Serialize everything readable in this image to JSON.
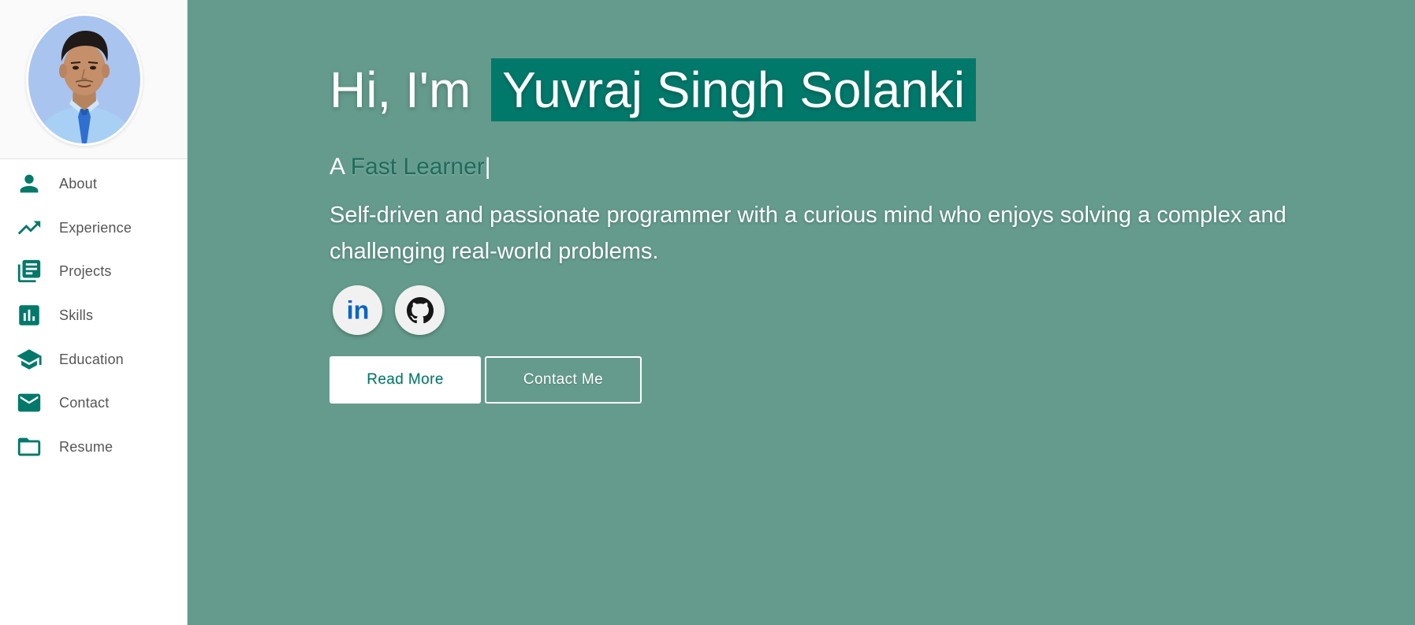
{
  "sidebar": {
    "avatar_alt": "Profile photo",
    "items": [
      {
        "label": "About",
        "icon": "person-icon"
      },
      {
        "label": "Experience",
        "icon": "trending-up-icon"
      },
      {
        "label": "Projects",
        "icon": "library-books-icon"
      },
      {
        "label": "Skills",
        "icon": "bar-chart-icon"
      },
      {
        "label": "Education",
        "icon": "school-icon"
      },
      {
        "label": "Contact",
        "icon": "mail-icon"
      },
      {
        "label": "Resume",
        "icon": "folder-icon"
      }
    ]
  },
  "hero": {
    "greeting_prefix": "Hi, I'm",
    "name": "Yuvraj Singh Solanki",
    "tagline_prefix": "A",
    "tagline_typed": "Fast Learner",
    "tagline_cursor": "|",
    "bio": "Self-driven and passionate programmer with a curious mind who enjoys solving a complex and challenging real-world problems.",
    "socials": [
      {
        "name": "linkedin-icon",
        "label": "in"
      },
      {
        "name": "github-icon"
      }
    ],
    "buttons": {
      "read_more": "Read More",
      "contact_me": "Contact Me"
    }
  },
  "colors": {
    "accent": "#00796b",
    "main_background": "#649b8d",
    "sidebar_background": "#ffffff",
    "typed_text": "#1e6b5b",
    "linkedin_blue": "#0a66c2"
  }
}
